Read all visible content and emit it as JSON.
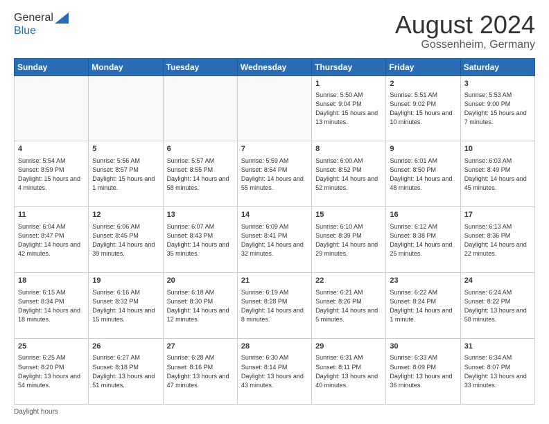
{
  "header": {
    "logo_general": "General",
    "logo_blue": "Blue",
    "month_title": "August 2024",
    "location": "Gossenheim, Germany"
  },
  "footer": {
    "note": "Daylight hours"
  },
  "days_of_week": [
    "Sunday",
    "Monday",
    "Tuesday",
    "Wednesday",
    "Thursday",
    "Friday",
    "Saturday"
  ],
  "weeks": [
    [
      {
        "day": "",
        "info": ""
      },
      {
        "day": "",
        "info": ""
      },
      {
        "day": "",
        "info": ""
      },
      {
        "day": "",
        "info": ""
      },
      {
        "day": "1",
        "info": "Sunrise: 5:50 AM\nSunset: 9:04 PM\nDaylight: 15 hours\nand 13 minutes."
      },
      {
        "day": "2",
        "info": "Sunrise: 5:51 AM\nSunset: 9:02 PM\nDaylight: 15 hours\nand 10 minutes."
      },
      {
        "day": "3",
        "info": "Sunrise: 5:53 AM\nSunset: 9:00 PM\nDaylight: 15 hours\nand 7 minutes."
      }
    ],
    [
      {
        "day": "4",
        "info": "Sunrise: 5:54 AM\nSunset: 8:59 PM\nDaylight: 15 hours\nand 4 minutes."
      },
      {
        "day": "5",
        "info": "Sunrise: 5:56 AM\nSunset: 8:57 PM\nDaylight: 15 hours\nand 1 minute."
      },
      {
        "day": "6",
        "info": "Sunrise: 5:57 AM\nSunset: 8:55 PM\nDaylight: 14 hours\nand 58 minutes."
      },
      {
        "day": "7",
        "info": "Sunrise: 5:59 AM\nSunset: 8:54 PM\nDaylight: 14 hours\nand 55 minutes."
      },
      {
        "day": "8",
        "info": "Sunrise: 6:00 AM\nSunset: 8:52 PM\nDaylight: 14 hours\nand 52 minutes."
      },
      {
        "day": "9",
        "info": "Sunrise: 6:01 AM\nSunset: 8:50 PM\nDaylight: 14 hours\nand 48 minutes."
      },
      {
        "day": "10",
        "info": "Sunrise: 6:03 AM\nSunset: 8:49 PM\nDaylight: 14 hours\nand 45 minutes."
      }
    ],
    [
      {
        "day": "11",
        "info": "Sunrise: 6:04 AM\nSunset: 8:47 PM\nDaylight: 14 hours\nand 42 minutes."
      },
      {
        "day": "12",
        "info": "Sunrise: 6:06 AM\nSunset: 8:45 PM\nDaylight: 14 hours\nand 39 minutes."
      },
      {
        "day": "13",
        "info": "Sunrise: 6:07 AM\nSunset: 8:43 PM\nDaylight: 14 hours\nand 35 minutes."
      },
      {
        "day": "14",
        "info": "Sunrise: 6:09 AM\nSunset: 8:41 PM\nDaylight: 14 hours\nand 32 minutes."
      },
      {
        "day": "15",
        "info": "Sunrise: 6:10 AM\nSunset: 8:39 PM\nDaylight: 14 hours\nand 29 minutes."
      },
      {
        "day": "16",
        "info": "Sunrise: 6:12 AM\nSunset: 8:38 PM\nDaylight: 14 hours\nand 25 minutes."
      },
      {
        "day": "17",
        "info": "Sunrise: 6:13 AM\nSunset: 8:36 PM\nDaylight: 14 hours\nand 22 minutes."
      }
    ],
    [
      {
        "day": "18",
        "info": "Sunrise: 6:15 AM\nSunset: 8:34 PM\nDaylight: 14 hours\nand 18 minutes."
      },
      {
        "day": "19",
        "info": "Sunrise: 6:16 AM\nSunset: 8:32 PM\nDaylight: 14 hours\nand 15 minutes."
      },
      {
        "day": "20",
        "info": "Sunrise: 6:18 AM\nSunset: 8:30 PM\nDaylight: 14 hours\nand 12 minutes."
      },
      {
        "day": "21",
        "info": "Sunrise: 6:19 AM\nSunset: 8:28 PM\nDaylight: 14 hours\nand 8 minutes."
      },
      {
        "day": "22",
        "info": "Sunrise: 6:21 AM\nSunset: 8:26 PM\nDaylight: 14 hours\nand 5 minutes."
      },
      {
        "day": "23",
        "info": "Sunrise: 6:22 AM\nSunset: 8:24 PM\nDaylight: 14 hours\nand 1 minute."
      },
      {
        "day": "24",
        "info": "Sunrise: 6:24 AM\nSunset: 8:22 PM\nDaylight: 13 hours\nand 58 minutes."
      }
    ],
    [
      {
        "day": "25",
        "info": "Sunrise: 6:25 AM\nSunset: 8:20 PM\nDaylight: 13 hours\nand 54 minutes."
      },
      {
        "day": "26",
        "info": "Sunrise: 6:27 AM\nSunset: 8:18 PM\nDaylight: 13 hours\nand 51 minutes."
      },
      {
        "day": "27",
        "info": "Sunrise: 6:28 AM\nSunset: 8:16 PM\nDaylight: 13 hours\nand 47 minutes."
      },
      {
        "day": "28",
        "info": "Sunrise: 6:30 AM\nSunset: 8:14 PM\nDaylight: 13 hours\nand 43 minutes."
      },
      {
        "day": "29",
        "info": "Sunrise: 6:31 AM\nSunset: 8:11 PM\nDaylight: 13 hours\nand 40 minutes."
      },
      {
        "day": "30",
        "info": "Sunrise: 6:33 AM\nSunset: 8:09 PM\nDaylight: 13 hours\nand 36 minutes."
      },
      {
        "day": "31",
        "info": "Sunrise: 6:34 AM\nSunset: 8:07 PM\nDaylight: 13 hours\nand 33 minutes."
      }
    ]
  ]
}
